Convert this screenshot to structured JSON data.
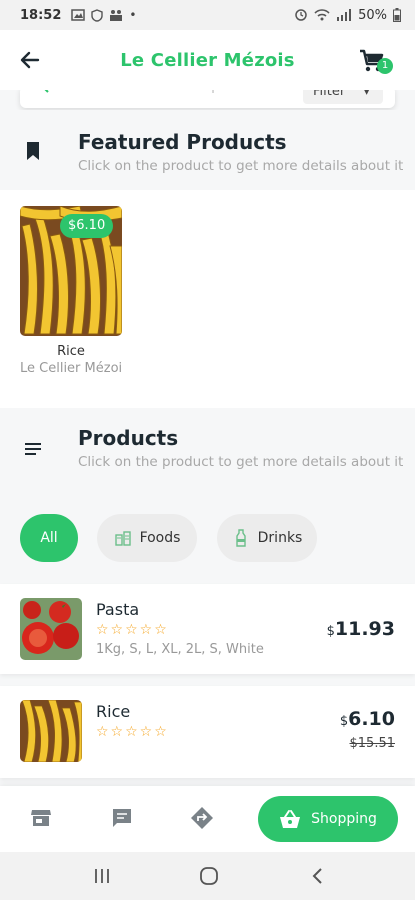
{
  "status_bar": {
    "time": "18:52",
    "battery": "50%"
  },
  "app_bar": {
    "title": "Le Cellier Mézois",
    "cart_count": "1"
  },
  "search": {
    "placeholder": "Search for markets or products",
    "filter_label": "Filter"
  },
  "featured": {
    "title": "Featured Products",
    "subtitle": "Click on the product to get more details about it",
    "items": [
      {
        "name": "Rice",
        "market": "Le Cellier Mézois",
        "price": "$6.10"
      }
    ]
  },
  "products": {
    "title": "Products",
    "subtitle": "Click on the product to get more details about it",
    "categories": [
      "All",
      "Foods",
      "Drinks"
    ],
    "items": [
      {
        "name": "Pasta",
        "stars": "☆☆☆☆☆",
        "options": "1Kg, S, L, XL, 2L, S, White",
        "currency": "$",
        "price": "11.93",
        "old_price": ""
      },
      {
        "name": "Rice",
        "stars": "☆☆☆☆☆",
        "options": "",
        "currency": "$",
        "price": "6.10",
        "old_price": "$15.51"
      }
    ]
  },
  "bottom_nav": {
    "shopping_label": "Shopping"
  },
  "colors": {
    "accent": "#2dc46c",
    "text_dark": "#1e2a32",
    "star": "#f5a623"
  }
}
